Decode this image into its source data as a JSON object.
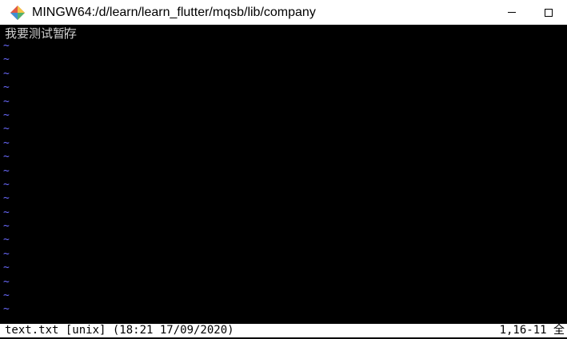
{
  "window": {
    "title": "MINGW64:/d/learn/learn_flutter/mqsb/lib/company",
    "app_icon": "git-diamond-icon",
    "controls": {
      "minimize_icon": "minimize-icon",
      "maximize_icon": "maximize-icon"
    }
  },
  "editor": {
    "line_before_cursor": "我要测试暂",
    "line_after_cursor": "存",
    "empty_line_marker": "~",
    "empty_line_count": 20
  },
  "statusbar": {
    "file_info": "text.txt [unix] (18:21 17/09/2020)",
    "position": "1,16-11 全"
  },
  "colors": {
    "terminal_bg": "#000000",
    "text": "#d0d0d0",
    "tilde": "#6b6bff",
    "statusbar_bg": "#ffffff"
  }
}
